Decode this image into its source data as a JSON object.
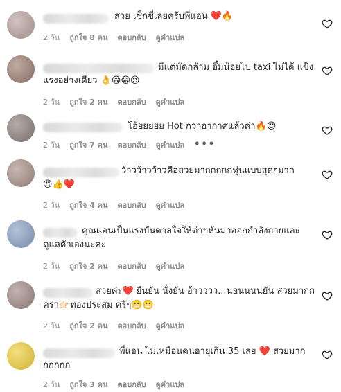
{
  "colors": {
    "text": "#262626",
    "meta": "#8e8e8e",
    "heart_red": "#ed1c40",
    "avatar_blur": [
      "#b9a39f",
      "#9c7d71",
      "#8d7f7b",
      "#a89187",
      "#8aa2c6",
      "#a08a86",
      "#f1cf3a"
    ]
  },
  "comments": [
    {
      "line1": "สวย เซ็กซี่เลยครับพี่แอน ❤️🔥",
      "line2": "",
      "time": "2 วัน",
      "likes": "ถูกใจ 8 คน",
      "reply": "ตอบกลับ",
      "translate": "ดูคำแปล",
      "more": ""
    },
    {
      "line1": "มีแต่มัดกล้าม อึ๋มน้อยไป taxi ไม่ได้ แข็ง",
      "line2": "แรงอย่างเดียว 👌😁😁😍",
      "time": "2 วัน",
      "likes": "ถูกใจ 2 คน",
      "reply": "ตอบกลับ",
      "translate": "ดูคำแปล",
      "more": ""
    },
    {
      "line1": "โอ้ยยยยย Hot กว่าอากาศแล้วค่า🔥😍",
      "line2": "",
      "time": "2 วัน",
      "likes": "ถูกใจ 7 คน",
      "reply": "ตอบกลับ",
      "translate": "ดูคำแปล",
      "more": "•••"
    },
    {
      "line1": "ว้าวว้าวว้าวคือสวยมากกกกกหุ่นแบบสุดๆมาก",
      "line2": "😍👍❤️",
      "time": "2 วัน",
      "likes": "ถูกใจ 4 คน",
      "reply": "ตอบกลับ",
      "translate": "ดูคำแปล",
      "more": ""
    },
    {
      "line1": "คุณแอนเป็นแรงบันดาลใจให้ต่ายหันมาออกกำลังกายและ",
      "line2": "ดูแลตัวเองนะคะ",
      "time": "2 วัน",
      "likes": "ถูกใจ 2 คน",
      "reply": "ตอบกลับ",
      "translate": "ดูคำแปล",
      "more": ""
    },
    {
      "line1": "สวยค่ะ❤️ ยืนยัน นั่งยัน อ้าวววว...นอนนนนยัน สวยมากก",
      "line2": "คร่า👉🏻ทองประสม ครีๆ😬😬",
      "time": "2 วัน",
      "likes": "ถูกใจ 2 คน",
      "reply": "ตอบกลับ",
      "translate": "ดูคำแปล",
      "more": ""
    },
    {
      "line1": "พี่แอน ไม่เหมือนคนอายุเกิน 35 เลย ❤️ สวยมาก",
      "line2": "กกกกก",
      "time": "2 วัน",
      "likes": "ถูกใจ 3 คน",
      "reply": "ตอบกลับ",
      "translate": "ดูคำแปล",
      "more": ""
    }
  ]
}
